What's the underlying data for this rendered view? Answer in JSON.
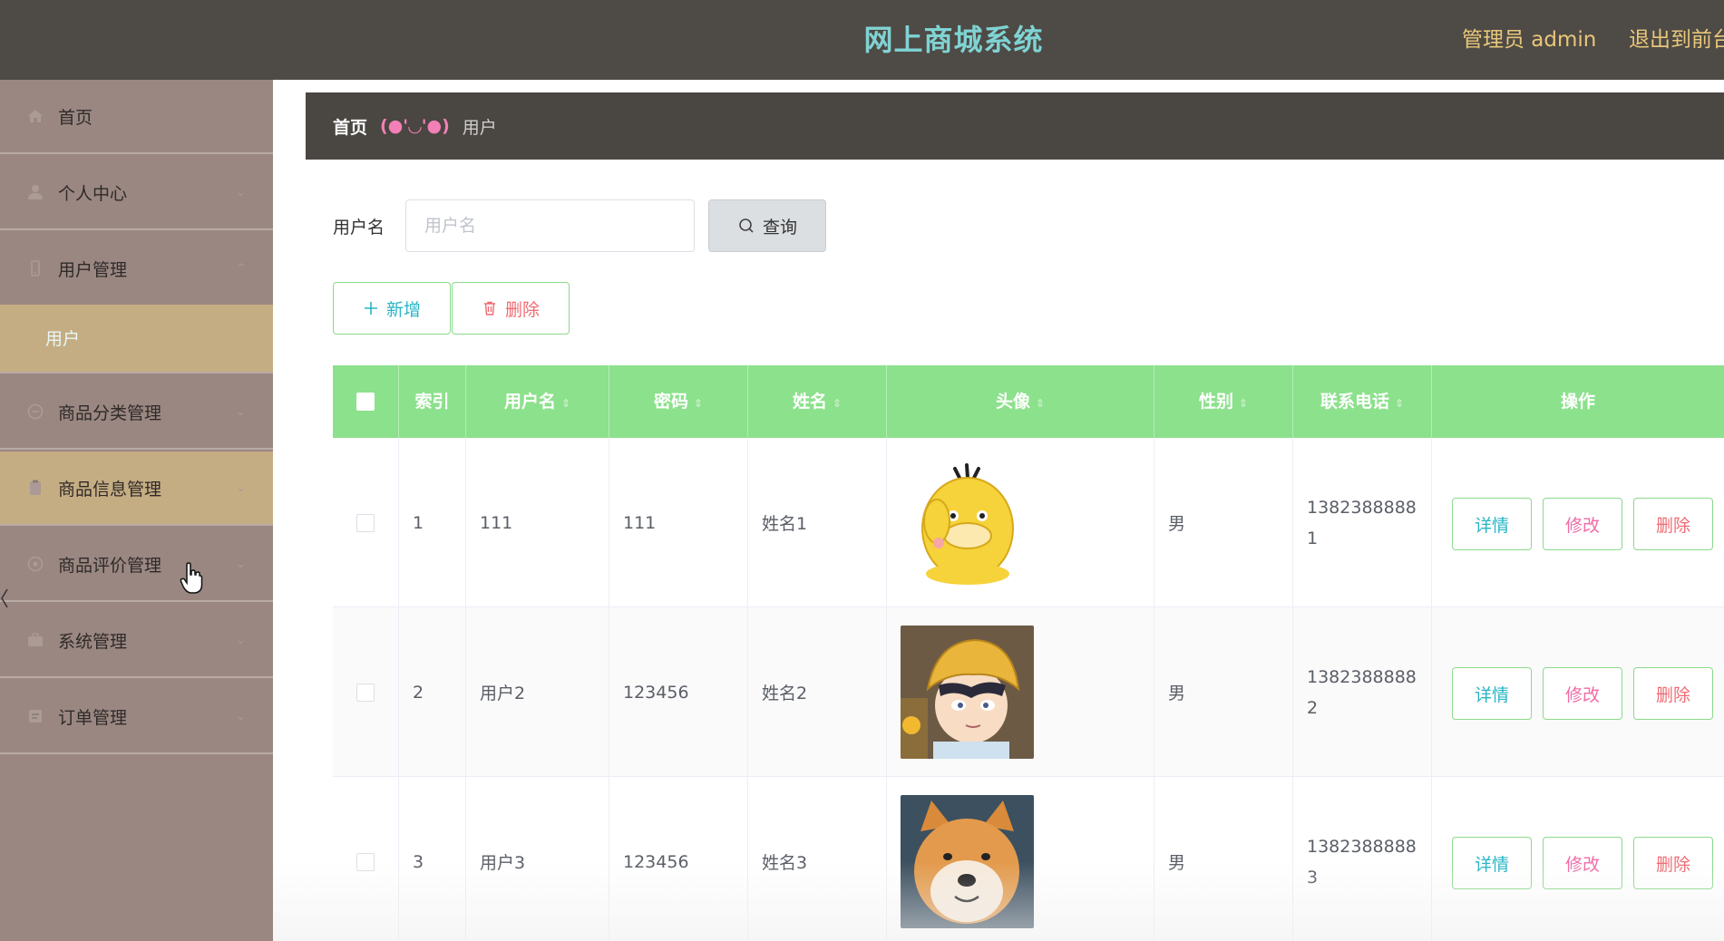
{
  "header": {
    "title": "网上商城系统",
    "admin_label": "管理员 admin",
    "logout_label": "退出到前台"
  },
  "sidebar": {
    "items": [
      {
        "label": "首页",
        "icon": "home-icon"
      },
      {
        "label": "个人中心",
        "icon": "user-icon"
      },
      {
        "label": "用户管理",
        "icon": "phone-icon"
      },
      {
        "label": "商品分类管理",
        "icon": "category-icon"
      },
      {
        "label": "商品信息管理",
        "icon": "clipboard-icon"
      },
      {
        "label": "商品评价管理",
        "icon": "comment-icon"
      },
      {
        "label": "系统管理",
        "icon": "settings-icon"
      },
      {
        "label": "订单管理",
        "icon": "order-icon"
      }
    ],
    "sub_item": "用户"
  },
  "breadcrumb": {
    "home": "首页",
    "separator": "(●'◡'●)",
    "current": "用户"
  },
  "search": {
    "label": "用户名",
    "placeholder": "用户名",
    "button": "查询"
  },
  "actions": {
    "add": "新增",
    "delete": "删除"
  },
  "table": {
    "columns": [
      "索引",
      "用户名",
      "密码",
      "姓名",
      "头像",
      "性别",
      "联系电话",
      "操作"
    ],
    "rows": [
      {
        "index": "1",
        "username": "111",
        "password": "111",
        "name": "姓名1",
        "avatar": "psyduck-avatar",
        "gender": "男",
        "phone": "13823888881"
      },
      {
        "index": "2",
        "username": "用户2",
        "password": "123456",
        "name": "姓名2",
        "avatar": "cartoon-boy-avatar",
        "gender": "男",
        "phone": "13823888882"
      },
      {
        "index": "3",
        "username": "用户3",
        "password": "123456",
        "name": "姓名3",
        "avatar": "shiba-dog-avatar",
        "gender": "男",
        "phone": "13823888883"
      }
    ],
    "row_actions": {
      "detail": "详情",
      "edit": "修改",
      "delete": "删除"
    }
  },
  "colors": {
    "topbar": "#4e4a45",
    "title": "#7fd3d3",
    "sidebar": "#9a8782",
    "active_menu": "#c5ad83",
    "table_header": "#8ce18c"
  }
}
